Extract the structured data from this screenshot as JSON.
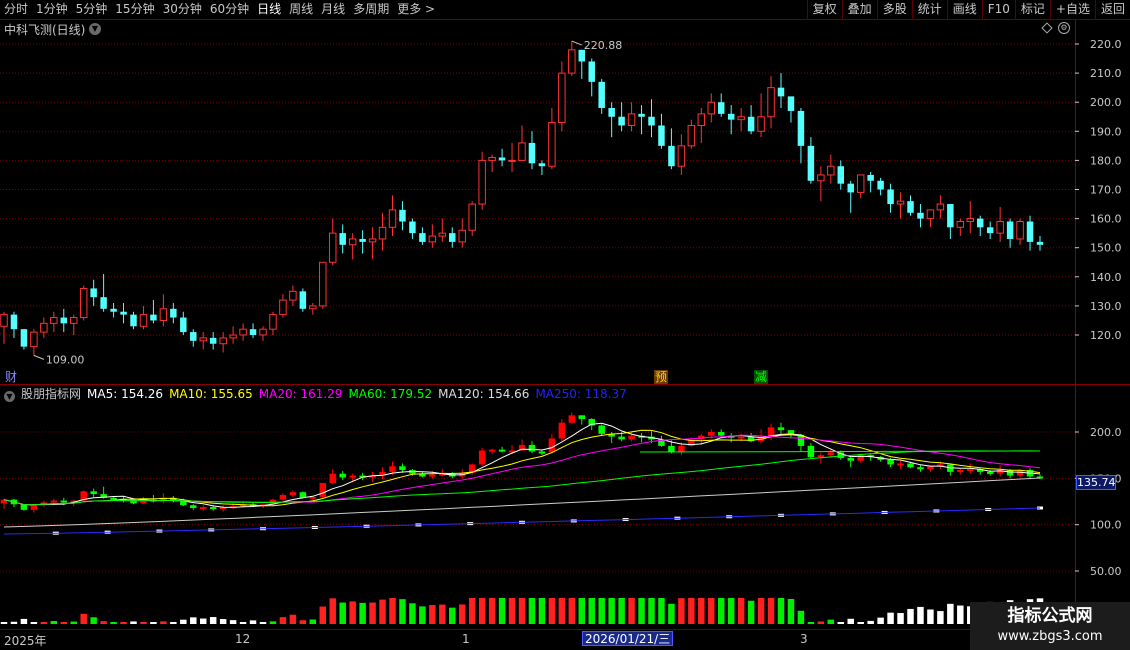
{
  "toolbar": {
    "periods": [
      "分时",
      "1分钟",
      "5分钟",
      "15分钟",
      "30分钟",
      "60分钟",
      "日线",
      "周线",
      "月线",
      "多周期",
      "更多 >"
    ],
    "active_period": "日线",
    "buttons": [
      "复权",
      "叠加",
      "多股",
      "统计",
      "画线",
      "F10",
      "标记",
      "+自选",
      "返回"
    ]
  },
  "stock": {
    "title": "中科飞测(日线)"
  },
  "price_axis": {
    "labels": [
      "220.0",
      "210.0",
      "200.0",
      "190.0",
      "180.0",
      "170.0",
      "160.0",
      "150.0",
      "140.0",
      "130.0",
      "120.0"
    ]
  },
  "annotations": {
    "high": "220.88",
    "low": "109.00"
  },
  "flags": {
    "cai": "财",
    "yu": "预",
    "jian": "减"
  },
  "indicator": {
    "name": "股朋指标网",
    "ma": [
      {
        "label": "MA5: 154.26",
        "color": "#ffffff"
      },
      {
        "label": "MA10: 155.65",
        "color": "#ffff00"
      },
      {
        "label": "MA20: 161.29",
        "color": "#ff00ff"
      },
      {
        "label": "MA60: 179.52",
        "color": "#00ff00"
      },
      {
        "label": "MA120: 154.66",
        "color": "#dddddd"
      },
      {
        "label": "MA250: 118.37",
        "color": "#2222ff"
      }
    ],
    "axis_labels": [
      "200.0",
      "150.0",
      "100.0",
      "50.00"
    ],
    "price_tag": "135.74"
  },
  "time_axis": {
    "labels": [
      "2025年",
      "12",
      "1",
      "2",
      "3"
    ],
    "cursor_date": "2026/01/21/三"
  },
  "watermark": {
    "title": "指标公式网",
    "url": "www.zbgs3.com"
  },
  "colors": {
    "up": "#ff3232",
    "down": "#54ffff",
    "grid": "#7a0000",
    "up_ind": "#ff0000",
    "down_ind": "#00ff00"
  },
  "chart_data": {
    "type": "candlestick",
    "price_range": [
      110,
      223
    ],
    "candles": [
      [
        123,
        128,
        117,
        127
      ],
      [
        127,
        128,
        119,
        122
      ],
      [
        122,
        122,
        115,
        116
      ],
      [
        116,
        122,
        113,
        121
      ],
      [
        121,
        126,
        119,
        124
      ],
      [
        124,
        128,
        121,
        126
      ],
      [
        126,
        129,
        121,
        124
      ],
      [
        124,
        127,
        120,
        126
      ],
      [
        126,
        137,
        125,
        136
      ],
      [
        136,
        139,
        130,
        133
      ],
      [
        133,
        141,
        128,
        129
      ],
      [
        129,
        131,
        126,
        128
      ],
      [
        128,
        131,
        124,
        127
      ],
      [
        127,
        128,
        122,
        123
      ],
      [
        123,
        130,
        122,
        127
      ],
      [
        127,
        132,
        124,
        125
      ],
      [
        125,
        134,
        123,
        129
      ],
      [
        129,
        131,
        124,
        126
      ],
      [
        126,
        128,
        120,
        121
      ],
      [
        121,
        122,
        116,
        118
      ],
      [
        118,
        121,
        115,
        119
      ],
      [
        119,
        121,
        115,
        117
      ],
      [
        117,
        121,
        114,
        119
      ],
      [
        119,
        123,
        117,
        120
      ],
      [
        120,
        124,
        118,
        122
      ],
      [
        122,
        124,
        119,
        120
      ],
      [
        120,
        123,
        118,
        122
      ],
      [
        122,
        128,
        120,
        127
      ],
      [
        127,
        134,
        126,
        132
      ],
      [
        132,
        137,
        130,
        135
      ],
      [
        135,
        136,
        128,
        129
      ],
      [
        129,
        131,
        127,
        130
      ],
      [
        130,
        145,
        129,
        145
      ],
      [
        145,
        160,
        144,
        155
      ],
      [
        155,
        158,
        148,
        151
      ],
      [
        151,
        155,
        146,
        153
      ],
      [
        153,
        156,
        148,
        152
      ],
      [
        152,
        157,
        146,
        153
      ],
      [
        153,
        162,
        149,
        157
      ],
      [
        157,
        168,
        154,
        163
      ],
      [
        163,
        166,
        156,
        159
      ],
      [
        159,
        160,
        153,
        155
      ],
      [
        155,
        157,
        151,
        152
      ],
      [
        152,
        158,
        150,
        154
      ],
      [
        154,
        160,
        152,
        155
      ],
      [
        155,
        157,
        150,
        152
      ],
      [
        152,
        160,
        150,
        156
      ],
      [
        156,
        166,
        154,
        165
      ],
      [
        165,
        183,
        163,
        180
      ],
      [
        180,
        182,
        176,
        181
      ],
      [
        181,
        184,
        178,
        180
      ],
      [
        180,
        186,
        176,
        180
      ],
      [
        180,
        192,
        180,
        186
      ],
      [
        186,
        190,
        177,
        179
      ],
      [
        179,
        180,
        175,
        178
      ],
      [
        178,
        198,
        177,
        193
      ],
      [
        193,
        214,
        190,
        210
      ],
      [
        210,
        221,
        209,
        218
      ],
      [
        218,
        218,
        208,
        214
      ],
      [
        214,
        215,
        202,
        207
      ],
      [
        207,
        208,
        196,
        198
      ],
      [
        198,
        200,
        188,
        195
      ],
      [
        195,
        200,
        190,
        192
      ],
      [
        192,
        200,
        190,
        196
      ],
      [
        196,
        199,
        189,
        195
      ],
      [
        195,
        201,
        188,
        192
      ],
      [
        192,
        196,
        184,
        185
      ],
      [
        185,
        191,
        177,
        178
      ],
      [
        178,
        189,
        175,
        185
      ],
      [
        185,
        194,
        184,
        192
      ],
      [
        192,
        198,
        186,
        196
      ],
      [
        196,
        203,
        193,
        200
      ],
      [
        200,
        203,
        195,
        196
      ],
      [
        196,
        199,
        189,
        194
      ],
      [
        194,
        198,
        190,
        195
      ],
      [
        195,
        199,
        189,
        190
      ],
      [
        190,
        203,
        188,
        195
      ],
      [
        195,
        209,
        191,
        205
      ],
      [
        205,
        210,
        198,
        202
      ],
      [
        202,
        200,
        193,
        197
      ],
      [
        197,
        198,
        179,
        185
      ],
      [
        185,
        188,
        172,
        173
      ],
      [
        173,
        178,
        166,
        175
      ],
      [
        175,
        182,
        172,
        178
      ],
      [
        178,
        180,
        170,
        172
      ],
      [
        172,
        173,
        162,
        169
      ],
      [
        169,
        174,
        167,
        175
      ],
      [
        175,
        176,
        169,
        173
      ],
      [
        173,
        174,
        168,
        170
      ],
      [
        170,
        172,
        162,
        165
      ],
      [
        165,
        169,
        160,
        166
      ],
      [
        166,
        168,
        161,
        162
      ],
      [
        162,
        165,
        157,
        160
      ],
      [
        160,
        163,
        157,
        163
      ],
      [
        163,
        168,
        160,
        165
      ],
      [
        165,
        165,
        153,
        157
      ],
      [
        157,
        160,
        154,
        159
      ],
      [
        159,
        166,
        155,
        160
      ],
      [
        160,
        161,
        154,
        157
      ],
      [
        157,
        159,
        153,
        155
      ],
      [
        155,
        164,
        152,
        159
      ],
      [
        159,
        160,
        150,
        153
      ],
      [
        153,
        160,
        151,
        159
      ],
      [
        159,
        161,
        149,
        152
      ],
      [
        152,
        154,
        149,
        151
      ]
    ]
  }
}
